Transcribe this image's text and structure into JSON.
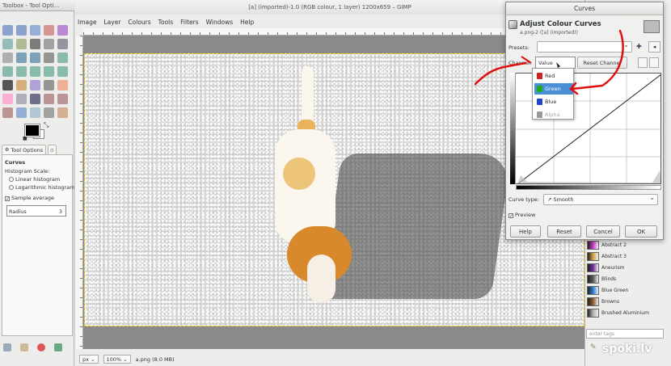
{
  "toolbox": {
    "title": "Toolbox - Tool Opti...",
    "tools": [
      "rect-select",
      "ellipse-select",
      "free-select",
      "fuzzy-select",
      "by-color-select",
      "scissors-select",
      "foreground-select",
      "paths",
      "color-picker",
      "zoom",
      "measure",
      "move",
      "align",
      "crop",
      "rotate",
      "scale",
      "shear",
      "perspective",
      "flip",
      "cage-transform",
      "text",
      "bucket-fill",
      "blend",
      "pencil",
      "paintbrush",
      "eraser",
      "airbrush",
      "ink",
      "clone",
      "heal",
      "perspective-clone",
      "blur",
      "smudge",
      "dodge-burn",
      "mypaint-brush"
    ],
    "tab_label": "Tool Options"
  },
  "tool_options": {
    "heading": "Curves",
    "histogram_scale_label": "Histogram Scale:",
    "linear_label": "Linear histogram",
    "log_label": "Logarithmic histogram",
    "sample_average_label": "Sample average",
    "radius_label": "Radius",
    "radius_value": "3"
  },
  "image_window": {
    "title": "[a] (imported)-1.0 (RGB colour, 1 layer) 1200x659 – GIMP",
    "menus": [
      "Image",
      "Layer",
      "Colours",
      "Tools",
      "Filters",
      "Windows",
      "Help"
    ],
    "status_unit": "px",
    "zoom": "100%",
    "status_text": "a.png (8.0 MB)"
  },
  "curves": {
    "window_title": "Curves",
    "heading": "Adjust Colour Curves",
    "subheading": "a.png-2 ([a] (imported))",
    "presets_label": "Presets:",
    "channel_label": "Channel:",
    "channel_value": "Value",
    "reset_channel_label": "Reset Channel",
    "curve_type_label": "Curve type:",
    "curve_type_value": "Smooth",
    "preview_label": "Preview",
    "buttons": {
      "help": "Help",
      "reset": "Reset",
      "cancel": "Cancel",
      "ok": "OK"
    },
    "channels": [
      {
        "label": "Red",
        "color": "#cc2222"
      },
      {
        "label": "Green",
        "color": "#22aa22"
      },
      {
        "label": "Blue",
        "color": "#2244cc"
      },
      {
        "label": "Alpha",
        "color": "#999999"
      }
    ],
    "selected_channel": "Green"
  },
  "gradients": [
    {
      "name": "Abstract 2",
      "color": "#c83ac8"
    },
    {
      "name": "Abstract 3",
      "color": "#d0a040"
    },
    {
      "name": "Aneurism",
      "color": "#6a2a9a"
    },
    {
      "name": "Blinds",
      "color": "#555555"
    },
    {
      "name": "Blue Green",
      "color": "#2a7ad0"
    },
    {
      "name": "Browns",
      "color": "#8a5a2a"
    },
    {
      "name": "Brushed Aluminium",
      "color": "#b0b0b0"
    }
  ],
  "tags_placeholder": "enter tags",
  "watermark": "spoki.lv",
  "accent": "#4a90d9",
  "annotation_color": "#e01010"
}
